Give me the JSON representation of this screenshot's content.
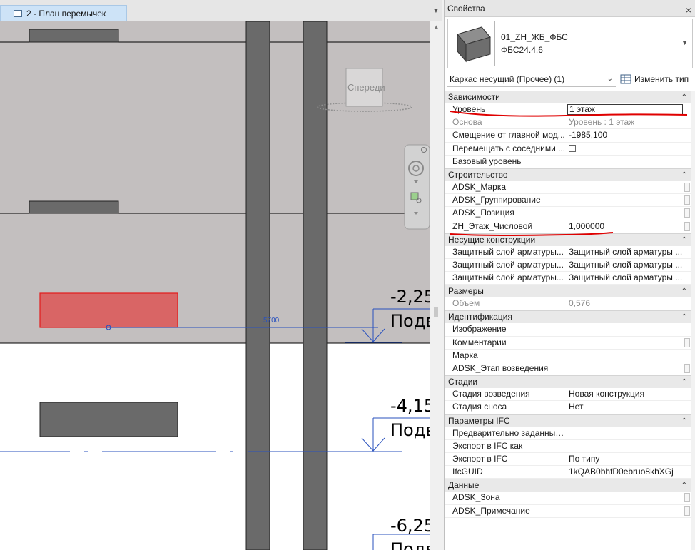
{
  "view": {
    "tab_label": "2 - План перемычек",
    "viewcube_label": "Спереди",
    "dimension_text": "5700",
    "level_markers": [
      {
        "elevation": "-2,25",
        "label": "Подв"
      },
      {
        "elevation": "-4,15",
        "label": "Подв"
      },
      {
        "elevation": "-6,25",
        "label": "Подв"
      }
    ]
  },
  "properties": {
    "title": "Свойства",
    "close": "×",
    "type_name_1": "01_ZH_ЖБ_ФБС",
    "type_name_2": "ФБС24.4.6",
    "filter_value": "Каркас несущий (Прочее) (1)",
    "edit_type_label": "Изменить тип",
    "groups": [
      {
        "name": "Зависимости",
        "rows": [
          {
            "name": "Уровень",
            "value": "1 этаж",
            "editing": true
          },
          {
            "name": "Основа",
            "value": "Уровень : 1 этаж",
            "readonly": true
          },
          {
            "name": "Смещение от главной мод...",
            "value": "-1985,100"
          },
          {
            "name": "Перемещать с соседними ...",
            "value": "",
            "checkbox": true
          },
          {
            "name": "Базовый уровень",
            "value": ""
          }
        ]
      },
      {
        "name": "Строительство",
        "rows": [
          {
            "name": "ADSK_Марка",
            "value": "",
            "button": true
          },
          {
            "name": "ADSK_Группирование",
            "value": "",
            "button": true
          },
          {
            "name": "ADSK_Позиция",
            "value": "",
            "button": true
          },
          {
            "name": "ZH_Этаж_Числовой",
            "value": "1,000000",
            "button": true
          }
        ]
      },
      {
        "name": "Несущие конструкции",
        "rows": [
          {
            "name": "Защитный слой арматуры...",
            "value": "Защитный слой арматуры ..."
          },
          {
            "name": "Защитный слой арматуры...",
            "value": "Защитный слой арматуры ..."
          },
          {
            "name": "Защитный слой арматуры...",
            "value": "Защитный слой арматуры ..."
          }
        ]
      },
      {
        "name": "Размеры",
        "rows": [
          {
            "name": "Объем",
            "value": "0,576",
            "readonly": true
          }
        ]
      },
      {
        "name": "Идентификация",
        "rows": [
          {
            "name": "Изображение",
            "value": ""
          },
          {
            "name": "Комментарии",
            "value": "",
            "button": true
          },
          {
            "name": "Марка",
            "value": ""
          },
          {
            "name": "ADSK_Этап возведения",
            "value": "",
            "button": true
          }
        ]
      },
      {
        "name": "Стадии",
        "rows": [
          {
            "name": "Стадия возведения",
            "value": "Новая конструкция"
          },
          {
            "name": "Стадия сноса",
            "value": "Нет"
          }
        ]
      },
      {
        "name": "Параметры IFC",
        "rows": [
          {
            "name": "Предварительно заданный...",
            "value": ""
          },
          {
            "name": "Экспорт в IFC как",
            "value": ""
          },
          {
            "name": "Экспорт в IFC",
            "value": "По типу"
          },
          {
            "name": "IfcGUID",
            "value": "1kQAB0bhfD0ebruo8khXGj"
          }
        ]
      },
      {
        "name": "Данные",
        "rows": [
          {
            "name": "ADSK_Зона",
            "value": "",
            "button": true
          },
          {
            "name": "ADSK_Примечание",
            "value": "",
            "button": true
          }
        ]
      }
    ]
  },
  "colors": {
    "section_fill": "#c3bfbf",
    "column_fill": "#6a6a6a",
    "selected_fill": "#d96565",
    "selected_stroke": "#e21a1a",
    "dimension_blue": "#2a52be",
    "markup_red": "#e00000"
  }
}
